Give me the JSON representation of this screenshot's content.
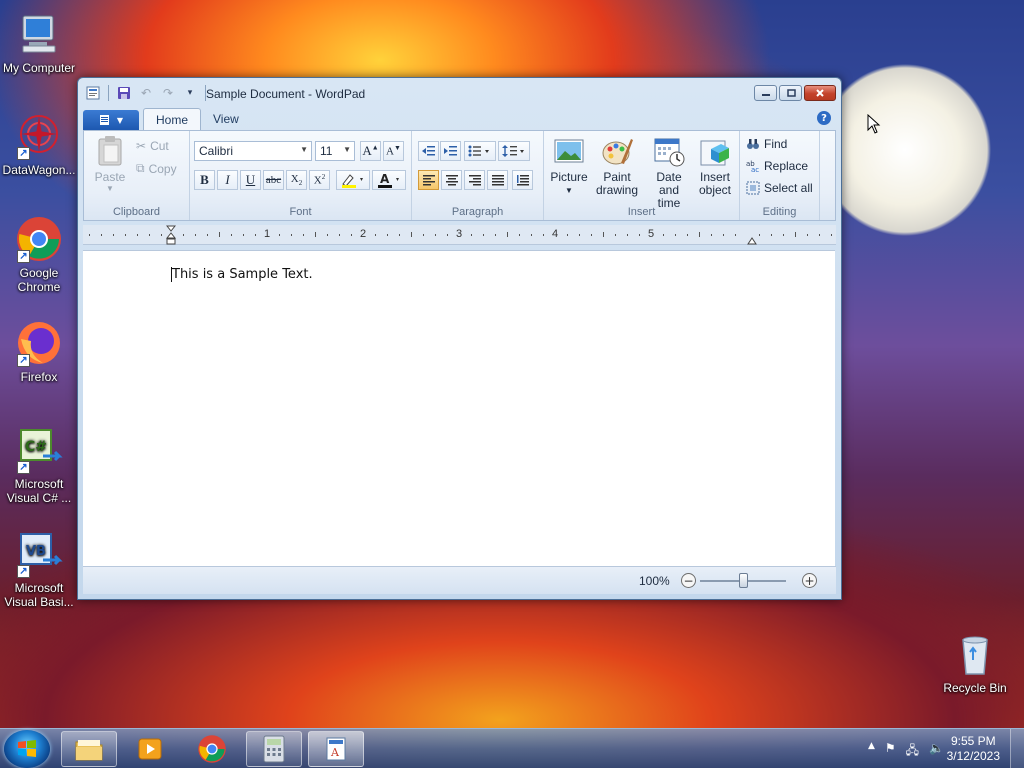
{
  "desktop": {
    "icons": [
      {
        "label": "My Computer"
      },
      {
        "label": "DataWagon..."
      },
      {
        "label": "Google Chrome"
      },
      {
        "label": "Firefox"
      },
      {
        "label": "Microsoft Visual C# ..."
      },
      {
        "label": "Microsoft Visual Basi..."
      },
      {
        "label": "Recycle Bin"
      }
    ]
  },
  "window": {
    "title": "Sample Document - WordPad",
    "tabs": [
      {
        "label": "Home"
      },
      {
        "label": "View"
      }
    ],
    "clipboard": {
      "paste": "Paste",
      "cut": "Cut",
      "copy": "Copy",
      "label": "Clipboard"
    },
    "font": {
      "family": "Calibri",
      "size": "11",
      "label": "Font"
    },
    "paragraph": {
      "label": "Paragraph"
    },
    "insert": {
      "picture": "Picture",
      "paint": "Paint drawing",
      "datetime": "Date and time",
      "object": "Insert object",
      "label": "Insert"
    },
    "editing": {
      "find": "Find",
      "replace": "Replace",
      "select_all": "Select all",
      "label": "Editing"
    },
    "ruler": {
      "numbers": [
        "1",
        "2",
        "3",
        "4",
        "5"
      ]
    },
    "document": {
      "text": "This is a Sample Text."
    },
    "status": {
      "zoom": "100%",
      "zoom_out": "−",
      "zoom_in": "+"
    }
  },
  "taskbar": {
    "clock_time": "9:55 PM",
    "clock_date": "3/12/2023"
  }
}
